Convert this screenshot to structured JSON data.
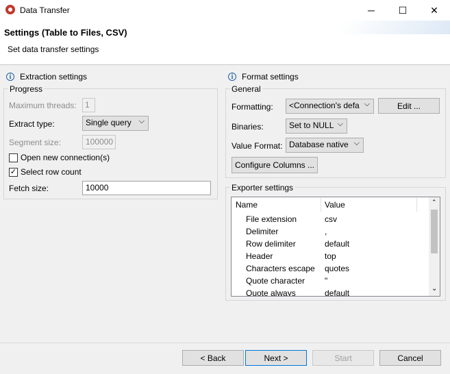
{
  "window": {
    "title": "Data Transfer",
    "minimize": "─",
    "maximize": "☐",
    "close": "✕"
  },
  "header": {
    "title": "Settings (Table to Files, CSV)",
    "description": "Set data transfer settings"
  },
  "extraction": {
    "section_title": "Extraction settings",
    "group_label": "Progress",
    "max_threads_label": "Maximum threads:",
    "max_threads_value": "1",
    "extract_type_label": "Extract type:",
    "extract_type_value": "Single query",
    "segment_size_label": "Segment size:",
    "segment_size_value": "100000",
    "open_new_connections_label": "Open new connection(s)",
    "open_new_connections_checked": false,
    "select_row_count_label": "Select row count",
    "select_row_count_checked": true,
    "fetch_size_label": "Fetch size:",
    "fetch_size_value": "10000"
  },
  "format": {
    "section_title": "Format settings",
    "group_label": "General",
    "formatting_label": "Formatting:",
    "formatting_value": "<Connection's defa",
    "edit_button": "Edit ...",
    "binaries_label": "Binaries:",
    "binaries_value": "Set to NULL",
    "value_format_label": "Value Format:",
    "value_format_value": "Database native",
    "configure_columns_button": "Configure Columns ..."
  },
  "exporter": {
    "group_label": "Exporter settings",
    "columns": [
      "Name",
      "Value"
    ],
    "rows": [
      {
        "name": "File extension",
        "value": "csv"
      },
      {
        "name": "Delimiter",
        "value": ","
      },
      {
        "name": "Row delimiter",
        "value": "default"
      },
      {
        "name": "Header",
        "value": "top"
      },
      {
        "name": "Characters escape",
        "value": "quotes"
      },
      {
        "name": "Quote character",
        "value": "\""
      },
      {
        "name": "Quote always",
        "value": "default"
      }
    ]
  },
  "footer": {
    "back": "< Back",
    "next": "Next >",
    "start": "Start",
    "cancel": "Cancel"
  },
  "colors": {
    "accent": "#0078d7",
    "info": "#1f5fa8",
    "app_icon": "#c0392b"
  }
}
